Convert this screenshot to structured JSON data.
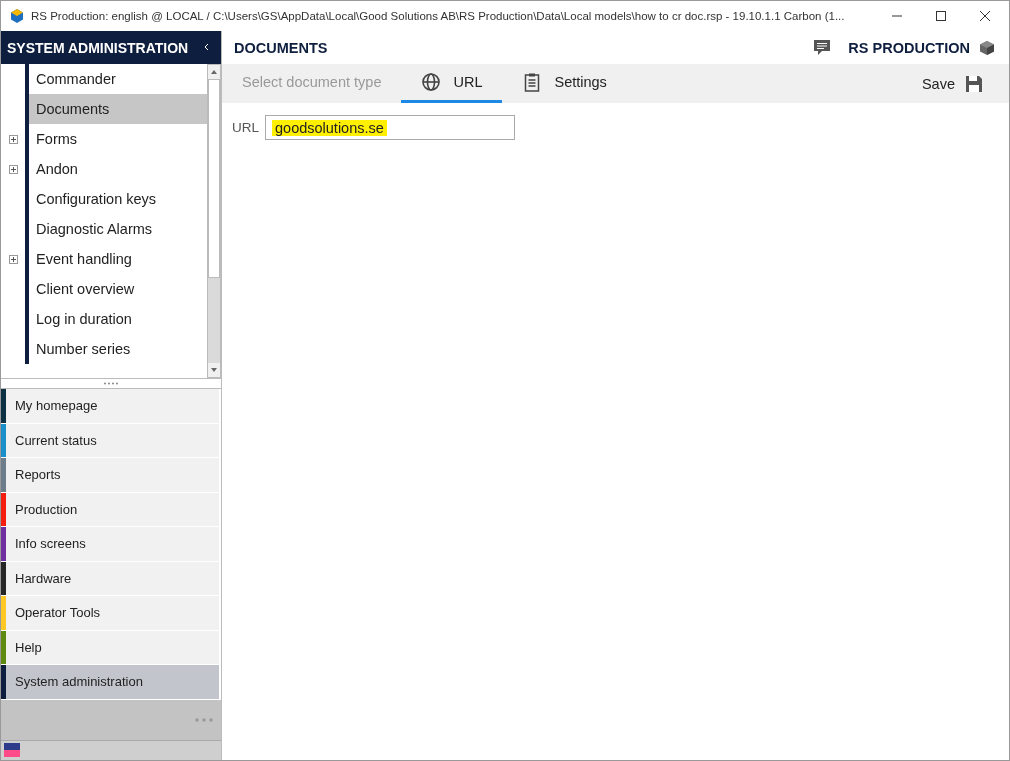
{
  "window": {
    "title": "RS Production: english @ LOCAL / C:\\Users\\GS\\AppData\\Local\\Good Solutions AB\\RS Production\\Data\\Local models\\how to cr doc.rsp - 19.10.1.1 Carbon (1..."
  },
  "sidebar": {
    "title": "SYSTEM ADMINISTRATION",
    "tree": [
      {
        "label": "Commander",
        "selected": false,
        "expandable": false
      },
      {
        "label": "Documents",
        "selected": true,
        "expandable": false
      },
      {
        "label": "Forms",
        "selected": false,
        "expandable": true
      },
      {
        "label": "Andon",
        "selected": false,
        "expandable": true
      },
      {
        "label": "Configuration keys",
        "selected": false,
        "expandable": false
      },
      {
        "label": "Diagnostic Alarms",
        "selected": false,
        "expandable": false
      },
      {
        "label": "Event handling",
        "selected": false,
        "expandable": true
      },
      {
        "label": "Client overview",
        "selected": false,
        "expandable": false
      },
      {
        "label": "Log in duration",
        "selected": false,
        "expandable": false
      },
      {
        "label": "Number series",
        "selected": false,
        "expandable": false
      }
    ],
    "modules": [
      {
        "label": "My homepage",
        "color": "#0d3042",
        "selected": false
      },
      {
        "label": "Current status",
        "color": "#1a8fc9",
        "selected": false
      },
      {
        "label": "Reports",
        "color": "#6e7d8a",
        "selected": false
      },
      {
        "label": "Production",
        "color": "#f51d0f",
        "selected": false
      },
      {
        "label": "Info screens",
        "color": "#7030a0",
        "selected": false
      },
      {
        "label": "Hardware",
        "color": "#262626",
        "selected": false
      },
      {
        "label": "Operator Tools",
        "color": "#ffc825",
        "selected": false
      },
      {
        "label": "Help",
        "color": "#5e8a10",
        "selected": false
      },
      {
        "label": "System administration",
        "color": "#0e1e3e",
        "selected": true
      }
    ]
  },
  "header": {
    "title": "DOCUMENTS",
    "brand": "RS PRODUCTION"
  },
  "tabs": [
    {
      "label": "Select document type",
      "kind": "disabled",
      "selected": false
    },
    {
      "label": "URL",
      "kind": "globe",
      "selected": true
    },
    {
      "label": "Settings",
      "kind": "clipboard",
      "selected": false
    }
  ],
  "save": "Save",
  "url_field": {
    "label": "URL",
    "value": "goodsolutions.se",
    "highlighted": true
  }
}
